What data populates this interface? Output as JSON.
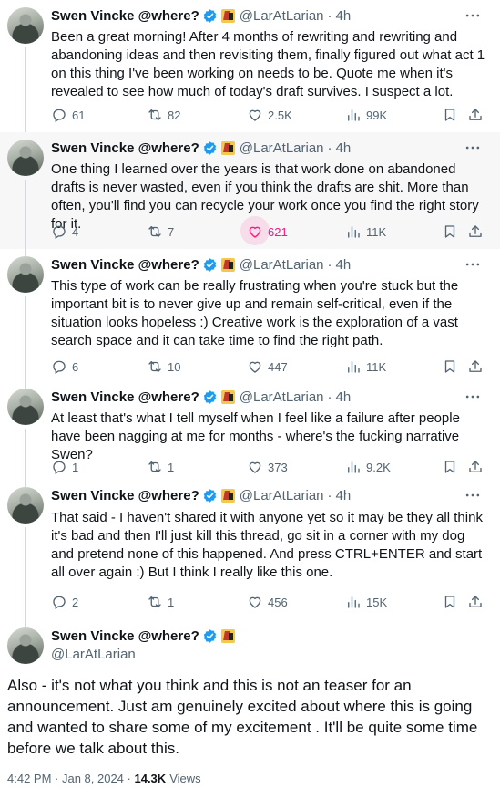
{
  "author": {
    "name": "Swen Vincke @where?",
    "handle": "@LarAtLarian"
  },
  "tweets": [
    {
      "time": "4h",
      "text": "Been a great morning! After 4 months of rewriting and rewriting and abandoning ideas and then revisiting them, finally figured out what act 1 on this thing I've been working on needs to be. Quote me when it's revealed to see how much of today's draft survives. I suspect a lot.",
      "replies": "61",
      "reposts": "82",
      "likes": "2.5K",
      "views": "99K"
    },
    {
      "time": "4h",
      "text": "One thing I learned over the years is that work done on abandoned drafts is never wasted, even if you think the drafts are shit. More than often, you'll find you can recycle your work once you find the right story for it.",
      "replies": "4",
      "reposts": "7",
      "likes": "621",
      "views": "11K"
    },
    {
      "time": "4h",
      "text": "This type of work can be really frustrating when you're stuck but the important bit is to never give up and remain self-critical, even if the situation looks hopeless :) Creative work is the exploration of a vast search space and it can take time to find the right path.",
      "replies": "6",
      "reposts": "10",
      "likes": "447",
      "views": "11K"
    },
    {
      "time": "4h",
      "text": "At least that's what I tell myself when I feel like a failure after people have been nagging at me for months - where's the fucking narrative Swen?",
      "replies": "1",
      "reposts": "1",
      "likes": "373",
      "views": "9.2K"
    },
    {
      "time": "4h",
      "text": "That said - I haven't shared it with anyone yet so it may be they all think it's bad and then I'll just kill this thread, go sit in a corner with my dog and pretend none of this happened. And press CTRL+ENTER and start all over again :) But I think I really like this one.",
      "replies": "2",
      "reposts": "1",
      "likes": "456",
      "views": "15K"
    }
  ],
  "main_tweet": {
    "text": "Also - it's not what you think and this is not an teaser for an announcement. Just am genuinely excited about where this is going and wanted to share some of my excitement . It'll be quite some time before we talk about this.",
    "timestamp": "4:42 PM · Jan 8, 2024",
    "views_count": "14.3K",
    "views_label": "Views"
  },
  "colors": {
    "verified": "#1d9bf0",
    "like_active": "#f91880",
    "muted": "#536471"
  },
  "icons": [
    "reply-icon",
    "repost-icon",
    "like-icon",
    "views-icon",
    "bookmark-icon",
    "share-icon",
    "more-icon",
    "verified-icon"
  ]
}
